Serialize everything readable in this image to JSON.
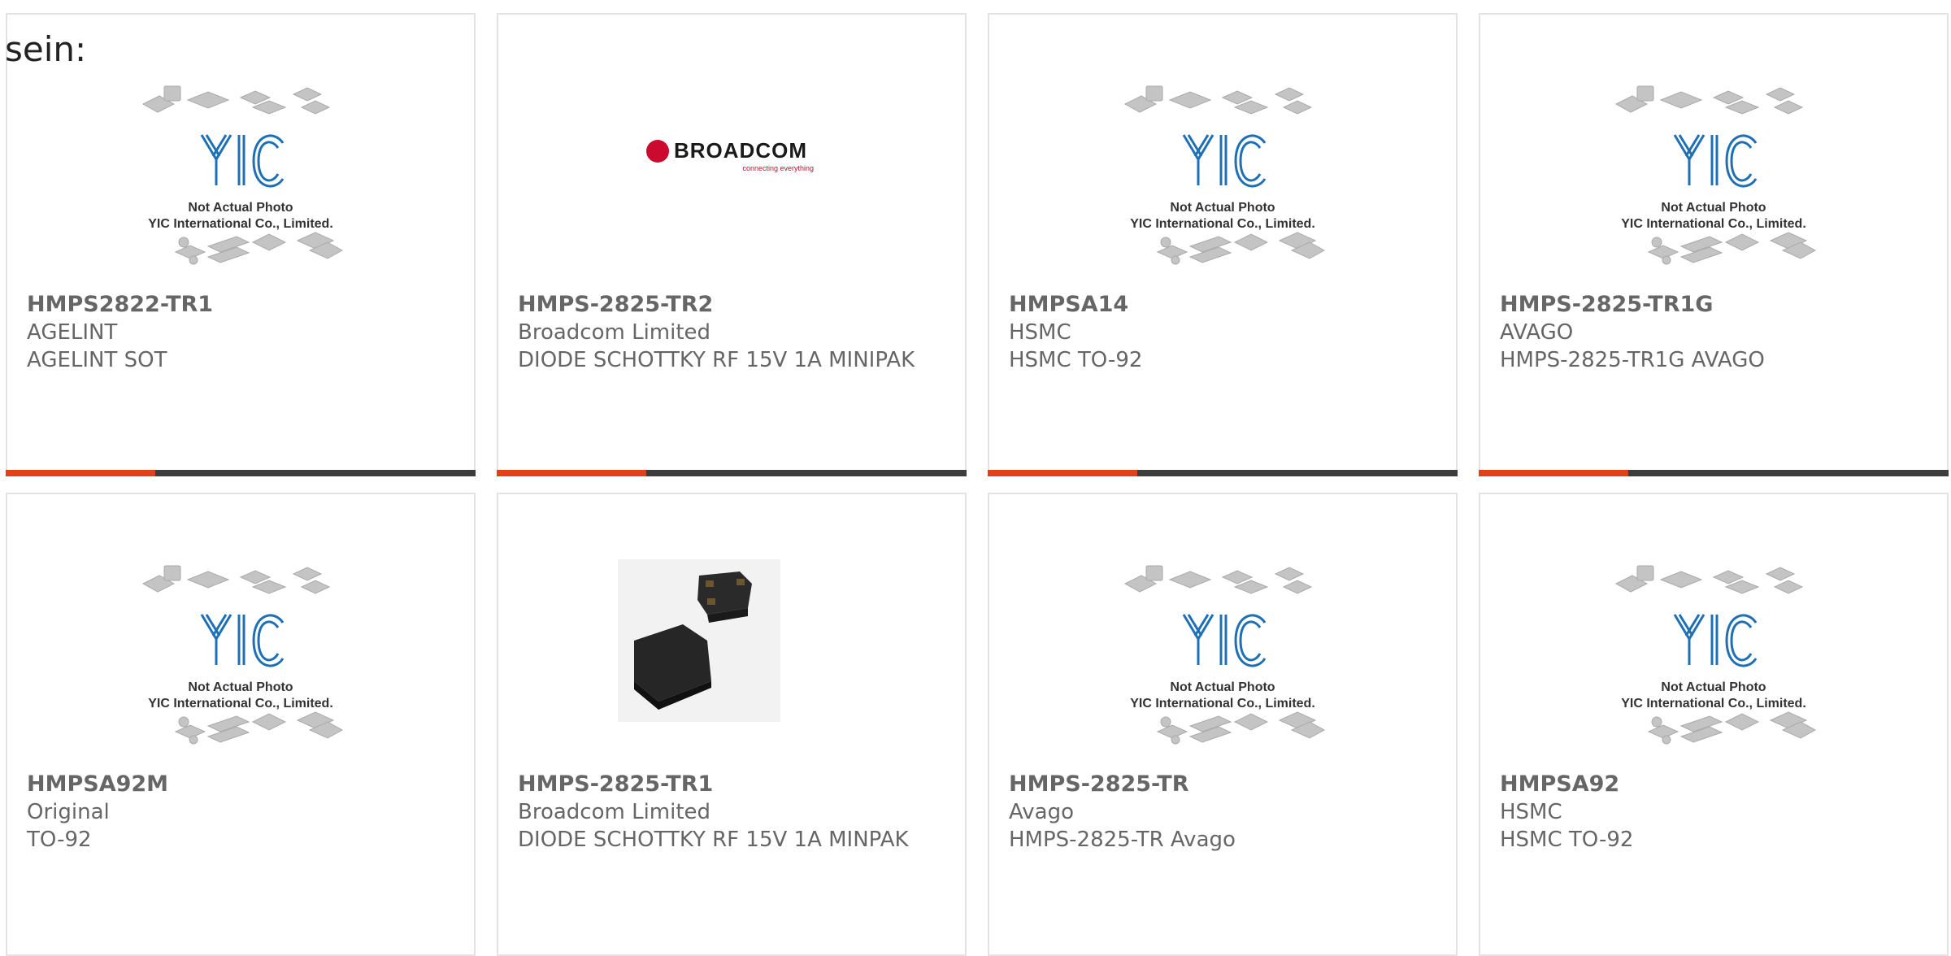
{
  "page": {
    "prefix_text": "sein:"
  },
  "placeholder": {
    "line1": "Not Actual Photo",
    "line2": "YIC International Co., Limited."
  },
  "brand_logo": {
    "name": "BROADCOM",
    "tagline": "connecting everything"
  },
  "colors": {
    "accent": "#e0401c",
    "bar_dark": "#3c3c3c",
    "text": "#666666",
    "border": "#e3e3e3"
  },
  "products": [
    {
      "part": "HMPS2822-TR1",
      "manufacturer": "AGELINT",
      "description": "AGELINT SOT",
      "image": "placeholder"
    },
    {
      "part": "HMPS-2825-TR2",
      "manufacturer": "Broadcom Limited",
      "description": "DIODE SCHOTTKY RF 15V 1A MINIPAK",
      "image": "broadcom-logo"
    },
    {
      "part": "HMPSA14",
      "manufacturer": "HSMC",
      "description": "HSMC TO-92",
      "image": "placeholder"
    },
    {
      "part": "HMPS-2825-TR1G",
      "manufacturer": "AVAGO",
      "description": "HMPS-2825-TR1G AVAGO",
      "image": "placeholder"
    },
    {
      "part": "HMPSA92M",
      "manufacturer": "Original",
      "description": "TO-92",
      "image": "placeholder"
    },
    {
      "part": "HMPS-2825-TR1",
      "manufacturer": "Broadcom Limited",
      "description": "DIODE SCHOTTKY RF 15V 1A MINPAK",
      "image": "component-photo"
    },
    {
      "part": "HMPS-2825-TR",
      "manufacturer": "Avago",
      "description": "HMPS-2825-TR Avago",
      "image": "placeholder"
    },
    {
      "part": "HMPSA92",
      "manufacturer": "HSMC",
      "description": "HSMC TO-92",
      "image": "placeholder"
    }
  ]
}
